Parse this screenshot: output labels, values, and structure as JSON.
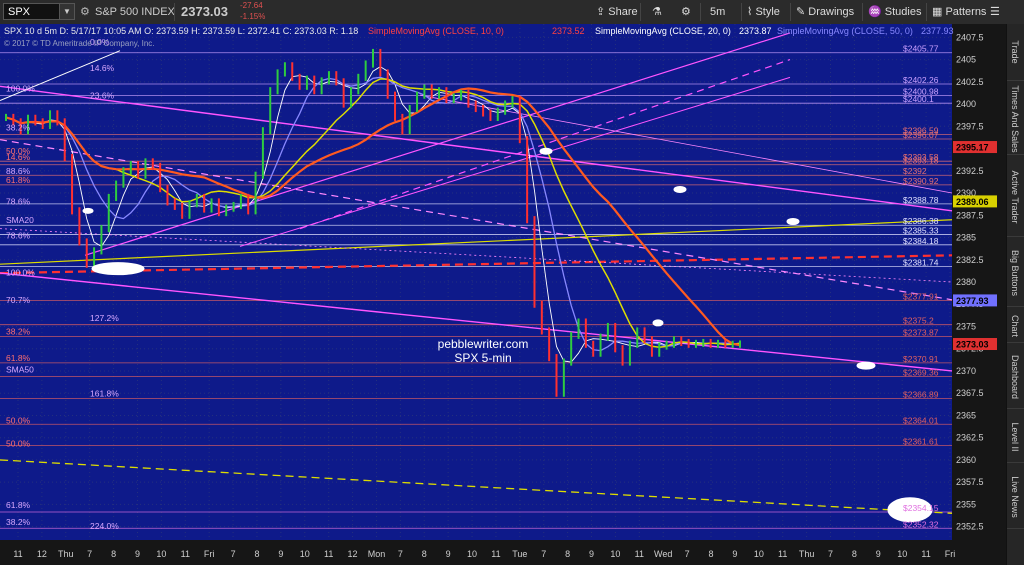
{
  "toolbar": {
    "symbol": "SPX",
    "description": "S&P 500 INDEX",
    "last": "2373.03",
    "change": "-27.64",
    "change_pct": "-1.15%",
    "share": "Share",
    "interval": "5m",
    "style": "Style",
    "drawings": "Drawings",
    "studies": "Studies",
    "patterns": "Patterns"
  },
  "sidebar": [
    "Trade",
    "Times And Sales",
    "Active Trader",
    "Big Buttons",
    "Chart",
    "Dashboard",
    "Level II",
    "Live News"
  ],
  "chart": {
    "header": "SPX 10 d 5m  D: 5/17/17 10:05 AM  O: 2373.59  H: 2373.59  L: 2372.41  C: 2373.03  R: 1.18",
    "copyright": "© 2017 © TD Ameritrade IP Company, Inc.",
    "studies": [
      {
        "label": "SimpleMovingAvg (CLOSE, 10, 0)",
        "value": "2373.52",
        "color": "#ff4040"
      },
      {
        "label": "SimpleMovingAvg (CLOSE, 20, 0)",
        "value": "2373.87",
        "color": "#ffffff"
      },
      {
        "label": "SimpleMovingAvg (CLOSE, 50, 0)",
        "value": "2377.93",
        "color": "#8888ff"
      }
    ],
    "watermark": [
      "pebblewriter.com",
      "SPX 5-min"
    ],
    "fib_labels": [
      {
        "text": "0.0%",
        "y": 2406.5
      },
      {
        "text": "14.6%",
        "y": 2403.6
      },
      {
        "text": "100.0%",
        "y": 2401.3
      },
      {
        "text": "23.6%",
        "y": 2400.5
      },
      {
        "text": "38.2%",
        "y": 2396.9
      },
      {
        "text": "50.0%",
        "y": 2394.3
      },
      {
        "text": "14.6%",
        "y": 2393.6
      },
      {
        "text": "88.6%",
        "y": 2392.0
      },
      {
        "text": "61.8%",
        "y": 2391.0
      },
      {
        "text": "78.6%",
        "y": 2388.6
      },
      {
        "text": "SMA20",
        "y": 2386.5
      },
      {
        "text": "78.6%",
        "y": 2384.8
      },
      {
        "text": "70.7%",
        "y": 2377.5
      },
      {
        "text": "127.2%",
        "y": 2375.5
      },
      {
        "text": "38.2%",
        "y": 2374.0
      },
      {
        "text": "61.8%",
        "y": 2371.0
      },
      {
        "text": "SMA50",
        "y": 2369.7
      },
      {
        "text": "161.8%",
        "y": 2367.0
      },
      {
        "text": "50.0%",
        "y": 2364.0
      },
      {
        "text": "50.0%",
        "y": 2361.4
      },
      {
        "text": "61.8%",
        "y": 2354.5
      },
      {
        "text": "38.2%",
        "y": 2352.6
      },
      {
        "text": "224.0%",
        "y": 2352.1
      },
      {
        "text": "100.0%",
        "y": 2380.6
      }
    ],
    "level_labels": [
      {
        "text": "$2405.77",
        "y": 2405.77
      },
      {
        "text": "$2402.26",
        "y": 2402.26
      },
      {
        "text": "$2400.98",
        "y": 2400.98
      },
      {
        "text": "$2400.1",
        "y": 2400.1
      },
      {
        "text": "$2396.59",
        "y": 2396.59
      },
      {
        "text": "$2396.07",
        "y": 2396.07
      },
      {
        "text": "$2393.58",
        "y": 2393.58
      },
      {
        "text": "$2393.18",
        "y": 2393.18
      },
      {
        "text": "$2392",
        "y": 2392.0
      },
      {
        "text": "$2390.92",
        "y": 2390.92
      },
      {
        "text": "$2388.78",
        "y": 2388.78
      },
      {
        "text": "$2386.38",
        "y": 2386.38
      },
      {
        "text": "$2385.33",
        "y": 2385.33
      },
      {
        "text": "$2384.18",
        "y": 2384.18
      },
      {
        "text": "$2381.74",
        "y": 2381.74
      },
      {
        "text": "$2377.91",
        "y": 2377.91
      },
      {
        "text": "$2375.2",
        "y": 2375.2
      },
      {
        "text": "$2373.87",
        "y": 2373.87
      },
      {
        "text": "$2370.91",
        "y": 2370.91
      },
      {
        "text": "$2369.36",
        "y": 2369.36
      },
      {
        "text": "$2366.89",
        "y": 2366.89
      },
      {
        "text": "$2364.01",
        "y": 2364.01
      },
      {
        "text": "$2361.61",
        "y": 2361.61
      },
      {
        "text": "$2354.15",
        "y": 2354.15
      },
      {
        "text": "$2352.32",
        "y": 2352.32
      }
    ],
    "price_ticks": [
      "2407.5",
      "2405",
      "2402.5",
      "2400",
      "2397.5",
      "2395",
      "2392.5",
      "2390",
      "2387.5",
      "2385",
      "2382.5",
      "2380",
      "2377.5",
      "2375",
      "2372.5",
      "2370",
      "2367.5",
      "2365",
      "2362.5",
      "2360",
      "2357.5",
      "2355",
      "2352.5"
    ],
    "price_tags": [
      {
        "text": "2395.17",
        "y": 2395.17,
        "color": "#e03030"
      },
      {
        "text": "2389.06",
        "y": 2389.06,
        "color": "#d8d000"
      },
      {
        "text": "2377.93",
        "y": 2377.93,
        "color": "#7070ff"
      },
      {
        "text": "2373.03",
        "y": 2373.03,
        "color": "#e03030"
      }
    ],
    "time_labels": [
      "11",
      "12",
      "Thu",
      "7",
      "8",
      "9",
      "10",
      "11",
      "Fri",
      "7",
      "8",
      "9",
      "10",
      "11",
      "12",
      "Mon",
      "7",
      "8",
      "9",
      "10",
      "11",
      "Tue",
      "7",
      "8",
      "9",
      "10",
      "11",
      "Wed",
      "7",
      "8",
      "9",
      "10",
      "11",
      "Thu",
      "7",
      "8",
      "9",
      "10",
      "11",
      "Fri"
    ]
  },
  "chart_data": {
    "type": "line",
    "symbol": "SPX",
    "interval": "5m",
    "ylim": [
      2351,
      2409
    ],
    "series": [
      {
        "name": "SPX",
        "x": [
          0,
          1,
          2,
          3,
          4,
          5,
          6,
          7,
          8,
          9,
          10,
          11,
          12,
          13,
          14,
          15,
          16,
          17,
          18,
          19,
          20,
          21,
          22,
          23,
          24,
          25,
          26,
          27,
          28,
          29,
          30,
          31,
          32,
          33,
          34,
          35,
          36,
          37,
          38,
          39,
          40,
          41,
          42,
          43,
          44,
          45,
          46,
          47,
          48,
          49,
          50,
          51,
          52,
          53,
          54,
          55,
          56,
          57,
          58,
          59,
          60,
          61,
          62,
          63,
          64,
          65,
          66,
          67,
          68,
          69,
          70,
          71,
          72,
          73,
          74,
          75,
          76,
          77,
          78,
          79,
          80,
          81,
          82,
          83,
          84,
          85,
          86,
          87,
          88,
          89,
          90,
          91,
          92,
          93,
          94,
          95,
          96,
          97,
          98,
          99,
          100
        ],
        "values": [
          2398.5,
          2398.0,
          2397.0,
          2398.4,
          2398.0,
          2397.6,
          2398.9,
          2398.0,
          2394.0,
          2388.0,
          2384.5,
          2382.0,
          2383.5,
          2386.0,
          2389.5,
          2391.0,
          2392.5,
          2393.2,
          2392.0,
          2393.5,
          2393.0,
          2390.5,
          2389.0,
          2388.5,
          2387.5,
          2388.8,
          2389.5,
          2388.2,
          2389.0,
          2387.8,
          2388.3,
          2388.6,
          2389.5,
          2388.0,
          2392.0,
          2397.0,
          2401.5,
          2403.5,
          2404.3,
          2403.0,
          2402.0,
          2402.8,
          2401.5,
          2402.6,
          2403.3,
          2402.5,
          2400.0,
          2401.5,
          2403.0,
          2404.5,
          2405.8,
          2403.5,
          2401.0,
          2398.5,
          2397.0,
          2399.5,
          2401.0,
          2401.8,
          2401.0,
          2401.5,
          2400.5,
          2400.8,
          2401.2,
          2400.0,
          2399.5,
          2399.0,
          2398.5,
          2399.2,
          2400.0,
          2400.5,
          2396.0,
          2387.0,
          2377.5,
          2374.5,
          2371.5,
          2367.5,
          2371.0,
          2374.0,
          2375.5,
          2373.0,
          2372.0,
          2373.8,
          2375.0,
          2372.5,
          2371.0,
          2373.0,
          2374.5,
          2373.5,
          2372.0,
          2372.8,
          2373.0,
          2373.5,
          2373.2,
          2373.0,
          2373.1,
          2373.2,
          2373.0,
          2373.1,
          2373.0,
          2373.0,
          2373.03
        ]
      }
    ],
    "studies": [
      {
        "name": "SimpleMovingAvg (CLOSE, 10, 0)",
        "last": 2373.52
      },
      {
        "name": "SimpleMovingAvg (CLOSE, 20, 0)",
        "last": 2373.87
      },
      {
        "name": "SimpleMovingAvg (CLOSE, 50, 0)",
        "last": 2377.93
      }
    ],
    "levels": [
      2405.77,
      2402.26,
      2400.98,
      2400.1,
      2396.59,
      2396.07,
      2393.58,
      2393.18,
      2392,
      2390.92,
      2388.78,
      2386.38,
      2385.33,
      2384.18,
      2381.74,
      2377.91,
      2375.2,
      2373.87,
      2370.91,
      2369.36,
      2366.89,
      2364.01,
      2361.61,
      2354.15,
      2352.32
    ],
    "grid": true
  }
}
